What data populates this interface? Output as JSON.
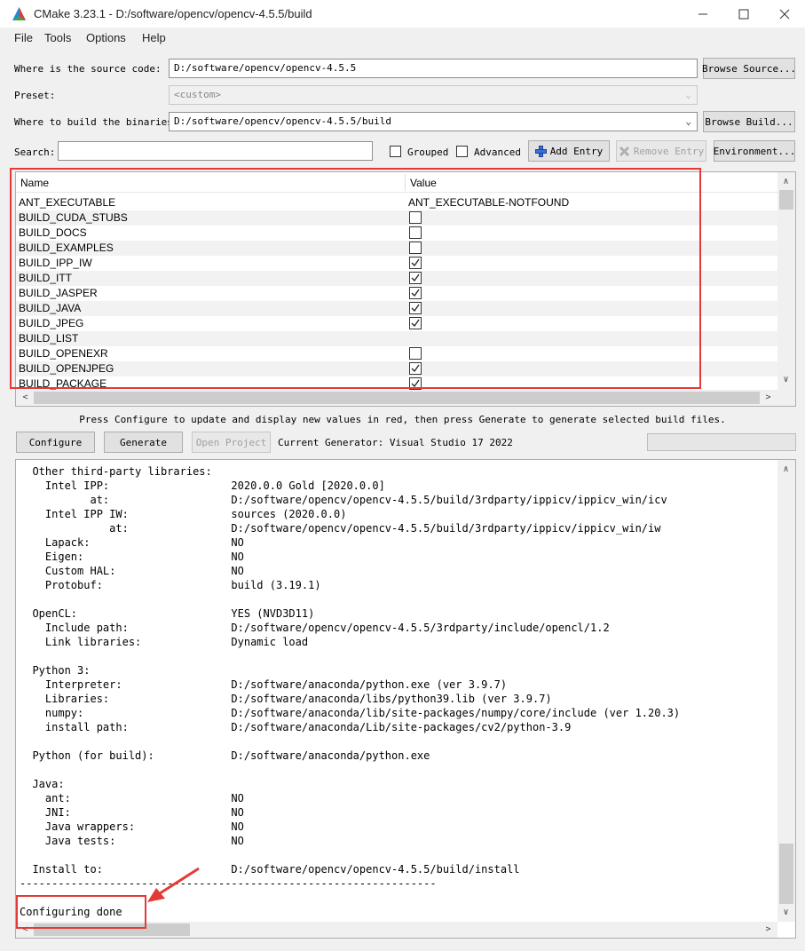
{
  "window": {
    "title": "CMake 3.23.1 - D:/software/opencv/opencv-4.5.5/build"
  },
  "menu": [
    "File",
    "Tools",
    "Options",
    "Help"
  ],
  "source": {
    "label": "Where is the source code:",
    "value": "D:/software/opencv/opencv-4.5.5",
    "button": "Browse Source..."
  },
  "preset": {
    "label": "Preset:",
    "value": "<custom>"
  },
  "build": {
    "label": "Where to build the binaries:",
    "value": "D:/software/opencv/opencv-4.5.5/build",
    "button": "Browse Build..."
  },
  "search": {
    "label": "Search:",
    "value": ""
  },
  "options": {
    "grouped": "Grouped",
    "advanced": "Advanced",
    "add_entry": "Add Entry",
    "remove_entry": "Remove Entry",
    "environment": "Environment..."
  },
  "table": {
    "columns": [
      "Name",
      "Value"
    ],
    "rows": [
      {
        "name": "ANT_EXECUTABLE",
        "value": "ANT_EXECUTABLE-NOTFOUND",
        "type": "text"
      },
      {
        "name": "BUILD_CUDA_STUBS",
        "type": "bool",
        "checked": false
      },
      {
        "name": "BUILD_DOCS",
        "type": "bool",
        "checked": false
      },
      {
        "name": "BUILD_EXAMPLES",
        "type": "bool",
        "checked": false
      },
      {
        "name": "BUILD_IPP_IW",
        "type": "bool",
        "checked": true
      },
      {
        "name": "BUILD_ITT",
        "type": "bool",
        "checked": true
      },
      {
        "name": "BUILD_JASPER",
        "type": "bool",
        "checked": true
      },
      {
        "name": "BUILD_JAVA",
        "type": "bool",
        "checked": true
      },
      {
        "name": "BUILD_JPEG",
        "type": "bool",
        "checked": true
      },
      {
        "name": "BUILD_LIST",
        "value": "",
        "type": "text"
      },
      {
        "name": "BUILD_OPENEXR",
        "type": "bool",
        "checked": false
      },
      {
        "name": "BUILD_OPENJPEG",
        "type": "bool",
        "checked": true
      },
      {
        "name": "BUILD_PACKAGE",
        "type": "bool",
        "checked": true
      }
    ]
  },
  "hint": "Press Configure to update and display new values in red, then press Generate to generate selected build files.",
  "actions": {
    "configure": "Configure",
    "generate": "Generate",
    "open_project": "Open Project",
    "generator": "Current Generator: Visual Studio 17 2022"
  },
  "output": {
    "lines": [
      "  Other third-party libraries:",
      "    Intel IPP:                   2020.0.0 Gold [2020.0.0]",
      "           at:                   D:/software/opencv/opencv-4.5.5/build/3rdparty/ippicv/ippicv_win/icv",
      "    Intel IPP IW:                sources (2020.0.0)",
      "              at:                D:/software/opencv/opencv-4.5.5/build/3rdparty/ippicv/ippicv_win/iw",
      "    Lapack:                      NO",
      "    Eigen:                       NO",
      "    Custom HAL:                  NO",
      "    Protobuf:                    build (3.19.1)",
      "",
      "  OpenCL:                        YES (NVD3D11)",
      "    Include path:                D:/software/opencv/opencv-4.5.5/3rdparty/include/opencl/1.2",
      "    Link libraries:              Dynamic load",
      "",
      "  Python 3:",
      "    Interpreter:                 D:/software/anaconda/python.exe (ver 3.9.7)",
      "    Libraries:                   D:/software/anaconda/libs/python39.lib (ver 3.9.7)",
      "    numpy:                       D:/software/anaconda/lib/site-packages/numpy/core/include (ver 1.20.3)",
      "    install path:                D:/software/anaconda/Lib/site-packages/cv2/python-3.9",
      "",
      "  Python (for build):            D:/software/anaconda/python.exe",
      "",
      "  Java:",
      "    ant:                         NO",
      "    JNI:                         NO",
      "    Java wrappers:               NO",
      "    Java tests:                  NO",
      "",
      "  Install to:                    D:/software/opencv/opencv-4.5.5/build/install",
      "-----------------------------------------------------------------",
      "",
      "Configuring done"
    ]
  },
  "colors": {
    "highlight": "#e53935",
    "accent": "#0066cc"
  }
}
